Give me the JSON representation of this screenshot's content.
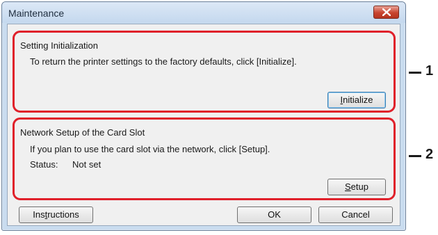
{
  "window": {
    "title": "Maintenance",
    "close_icon": "close-icon"
  },
  "sections": {
    "initialization": {
      "title": "Setting Initialization",
      "description": "To return the printer settings to the factory defaults, click [Initialize].",
      "button_prefix": "",
      "button_accel": "I",
      "button_rest": "nitialize"
    },
    "network": {
      "title": "Network Setup of the Card Slot",
      "description": "If you plan to use the card slot via the network, click [Setup].",
      "status_label": "Status:",
      "status_value": "Not set",
      "button_prefix": "",
      "button_accel": "S",
      "button_rest": "etup"
    }
  },
  "footer": {
    "instructions_prefix": "Ins",
    "instructions_accel": "t",
    "instructions_rest": "ructions",
    "ok_label": "OK",
    "cancel_label": "Cancel"
  },
  "callouts": {
    "one": "1",
    "two": "2"
  },
  "colors": {
    "highlight_border": "#e0202a",
    "dialog_bg": "#f0f0f0",
    "frame": "#c9dcef"
  }
}
